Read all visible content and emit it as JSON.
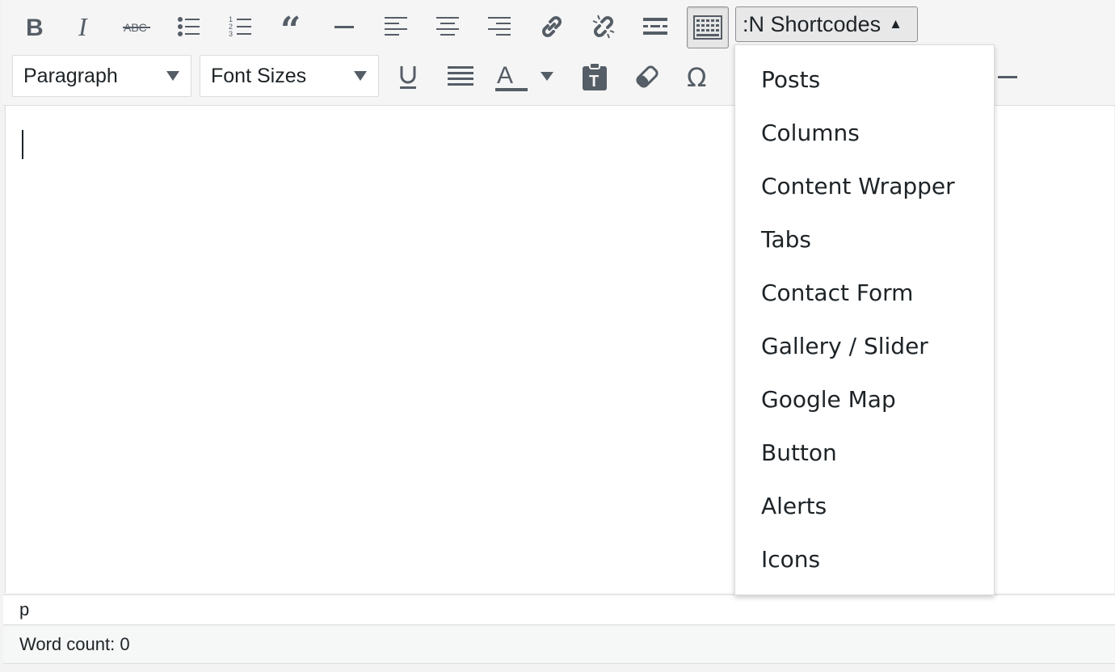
{
  "toolbar": {
    "row1_icons": [
      "bold-icon",
      "italic-icon",
      "strikethrough-icon",
      "bullet-list-icon",
      "numbered-list-icon",
      "blockquote-icon",
      "horizontal-rule-icon",
      "align-left-icon",
      "align-center-icon",
      "align-right-icon",
      "insert-link-icon",
      "remove-link-icon",
      "read-more-icon",
      "toolbar-toggle-icon"
    ],
    "shortcodes_label": ":N Shortcodes",
    "shortcodes_arrow": "▲",
    "format_select_value": "Paragraph",
    "font_size_select_value": "Font Sizes",
    "row2_icons": [
      "underline-icon",
      "justify-icon",
      "text-color-icon",
      "paste-as-text-icon",
      "clear-formatting-icon",
      "special-character-icon"
    ]
  },
  "dropdown": {
    "items": [
      "Posts",
      "Columns",
      "Content Wrapper",
      "Tabs",
      "Contact Form",
      "Gallery / Slider",
      "Google Map",
      "Button",
      "Alerts",
      "Icons"
    ]
  },
  "path_bar": {
    "text": "p"
  },
  "status_bar": {
    "word_count": "Word count: 0"
  },
  "colors": {
    "icon": "#555d66",
    "text": "#1d2327",
    "border": "#dcdcde"
  }
}
